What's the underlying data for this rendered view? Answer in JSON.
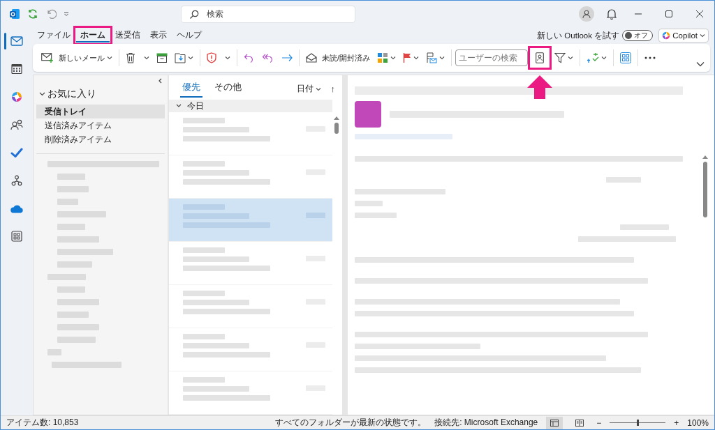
{
  "title_bar": {
    "search_placeholder": "検索"
  },
  "ribbon_tabs": [
    {
      "label": "ファイル",
      "selected": false,
      "highlighted": false
    },
    {
      "label": "ホーム",
      "selected": true,
      "highlighted": true
    },
    {
      "label": "送受信",
      "selected": false,
      "highlighted": false
    },
    {
      "label": "表示",
      "selected": false,
      "highlighted": false
    },
    {
      "label": "ヘルプ",
      "selected": false,
      "highlighted": false
    }
  ],
  "new_outlook": {
    "label": "新しい Outlook を試す",
    "toggle_text": "オフ",
    "on": false
  },
  "copilot": {
    "label": "Copilot"
  },
  "toolbar": {
    "new_mail": "新しいメール",
    "read_unread": "未読/開封済み",
    "people_search_placeholder": "ユーザーの検索",
    "address_book_highlighted": true
  },
  "nav": [
    {
      "kind": "mail",
      "selected": true
    },
    {
      "kind": "calendar",
      "selected": false
    },
    {
      "kind": "copilot",
      "selected": false
    },
    {
      "kind": "people",
      "selected": false
    },
    {
      "kind": "todo",
      "selected": false
    },
    {
      "kind": "groups",
      "selected": false
    },
    {
      "kind": "onedrive",
      "selected": false
    },
    {
      "kind": "apps",
      "selected": false
    }
  ],
  "folders": {
    "favorites_label": "お気に入り",
    "expanded": true,
    "items": [
      {
        "label": "受信トレイ",
        "selected": true
      },
      {
        "label": "送信済みアイテム",
        "selected": false
      },
      {
        "label": "削除済みアイテム",
        "selected": false
      }
    ]
  },
  "message_list": {
    "tabs": [
      {
        "label": "優先",
        "selected": true
      },
      {
        "label": "その他",
        "selected": false
      }
    ],
    "sort": "日付",
    "sort_direction": "↑",
    "group": "今日",
    "messages": [
      {
        "selected": false
      },
      {
        "selected": false
      },
      {
        "selected": true
      },
      {
        "selected": false
      },
      {
        "selected": false
      },
      {
        "selected": false
      },
      {
        "selected": false
      }
    ]
  },
  "status_bar": {
    "item_count": "アイテム数: 10,853",
    "sync": "すべてのフォルダーが最新の状態です。",
    "connection": "接続先: Microsoft Exchange",
    "zoom_out": "−",
    "zoom_in": "+",
    "zoom": "100%",
    "zoom_slider": {
      "level": 0.5
    }
  }
}
